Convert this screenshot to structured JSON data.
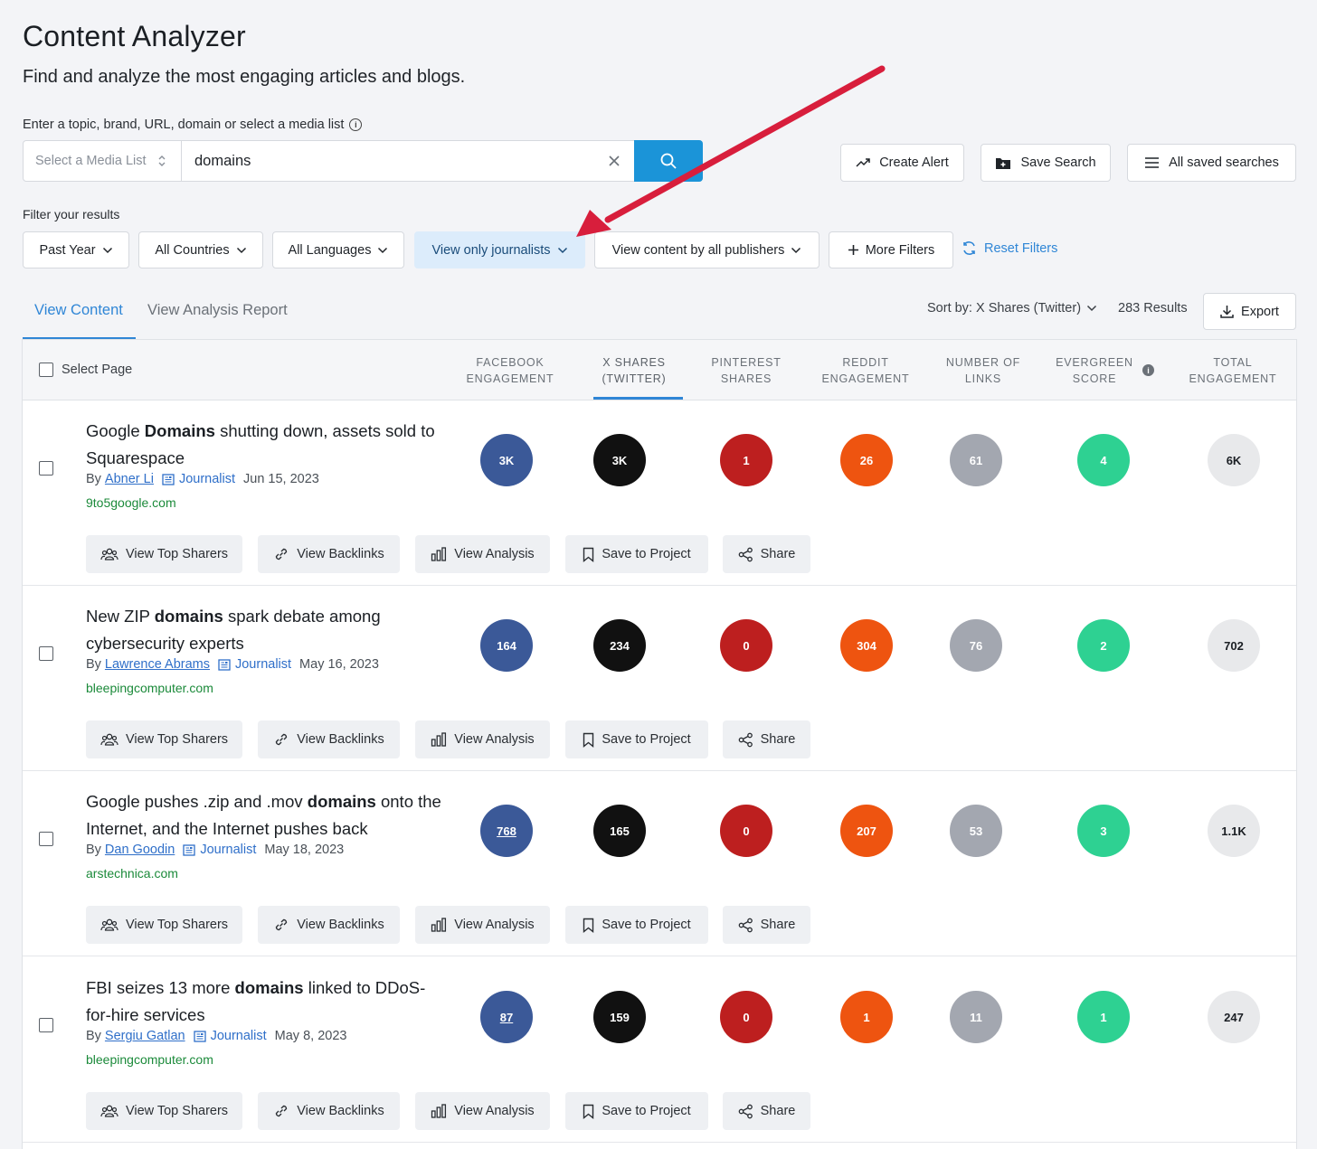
{
  "header": {
    "title": "Content Analyzer",
    "subtitle": "Find and analyze the most engaging articles and blogs."
  },
  "search": {
    "label": "Enter a topic, brand, URL, domain or select a media list",
    "media_list_placeholder": "Select a Media List",
    "query": "domains"
  },
  "top_actions": {
    "create_alert": "Create Alert",
    "save_search": "Save Search",
    "all_saved": "All saved searches"
  },
  "filters": {
    "label": "Filter your results",
    "date": "Past Year",
    "countries": "All Countries",
    "languages": "All Languages",
    "journalists": "View only journalists",
    "publishers": "View content by all publishers",
    "more": "More Filters",
    "reset": "Reset Filters"
  },
  "tabs": {
    "content": "View Content",
    "report": "View Analysis Report"
  },
  "toolbar": {
    "sort": "Sort by: X Shares (Twitter)",
    "results": "283 Results",
    "export": "Export"
  },
  "table": {
    "select_page": "Select Page",
    "columns": {
      "fb_1": "FACEBOOK",
      "fb_2": "ENGAGEMENT",
      "x_1": "X SHARES",
      "x_2": "(TWITTER)",
      "pin_1": "PINTEREST",
      "pin_2": "SHARES",
      "red_1": "REDDIT",
      "red_2": "ENGAGEMENT",
      "links_1": "NUMBER OF",
      "links_2": "LINKS",
      "ever_1": "EVERGREEN",
      "ever_2": "SCORE",
      "total_1": "TOTAL",
      "total_2": "ENGAGEMENT"
    },
    "action_labels": {
      "sharers": "View Top Sharers",
      "backlinks": "View Backlinks",
      "analysis": "View Analysis",
      "save": "Save to Project",
      "share": "Share"
    },
    "rows": [
      {
        "title_pre": "Google ",
        "title_bold": "Domains",
        "title_post": " shutting down, assets sold to Squarespace",
        "by": "By",
        "author": "Abner Li",
        "role": "Journalist",
        "date": "Jun 15, 2023",
        "domain": "9to5google.com",
        "fb": "3K",
        "x": "3K",
        "pin": "1",
        "reddit": "26",
        "links": "61",
        "evergreen": "4",
        "total": "6K"
      },
      {
        "title_pre": "New ZIP ",
        "title_bold": "domains",
        "title_post": " spark debate among cybersecurity experts",
        "by": "By",
        "author": "Lawrence Abrams",
        "role": "Journalist",
        "date": "May 16, 2023",
        "domain": "bleepingcomputer.com",
        "fb": "164",
        "x": "234",
        "pin": "0",
        "reddit": "304",
        "links": "76",
        "evergreen": "2",
        "total": "702"
      },
      {
        "title_pre": "Google pushes .zip and .mov ",
        "title_bold": "domains",
        "title_post": " onto the Internet, and the Internet pushes back",
        "by": "By",
        "author": "Dan Goodin",
        "role": "Journalist",
        "date": "May 18, 2023",
        "domain": "arstechnica.com",
        "fb": "768",
        "x": "165",
        "pin": "0",
        "reddit": "207",
        "links": "53",
        "evergreen": "3",
        "total": "1.1K"
      },
      {
        "title_pre": "FBI seizes 13 more ",
        "title_bold": "domains",
        "title_post": " linked to DDoS-for-hire services",
        "by": "By",
        "author": "Sergiu Gatlan",
        "role": "Journalist",
        "date": "May 8, 2023",
        "domain": "bleepingcomputer.com",
        "fb": "87",
        "x": "159",
        "pin": "0",
        "reddit": "1",
        "links": "11",
        "evergreen": "1",
        "total": "247"
      }
    ]
  },
  "colors": {
    "accent": "#2f86d6",
    "search_button": "#1b94d8",
    "facebook": "#3b5998",
    "x": "#111111",
    "pinterest": "#bd1f1f",
    "reddit": "#ee5410",
    "links": "#a3a7b0",
    "evergreen": "#2ed192",
    "total": "#e8e9eb",
    "annotation_arrow": "#d81e3c"
  }
}
